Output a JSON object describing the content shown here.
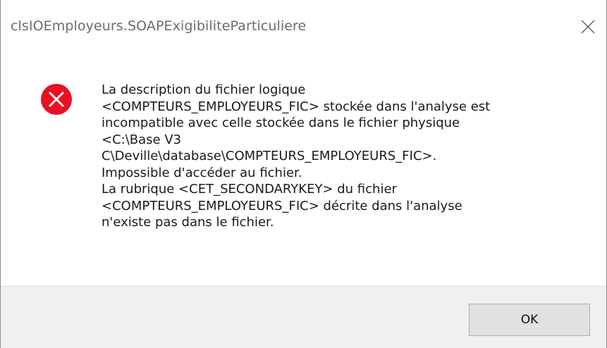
{
  "window": {
    "title": "clsIOEmployeurs.SOAPExigibiliteParticuliere",
    "close_icon": "close-icon"
  },
  "message": {
    "icon": "error-icon",
    "icon_color": "#e81123",
    "text": "La description du fichier logique\n<COMPTEURS_EMPLOYEURS_FIC> stockée dans l'analyse est\nincompatible avec celle stockée dans le fichier physique\n<C:\\Base V3\nC\\Deville\\database\\COMPTEURS_EMPLOYEURS_FIC>.\nImpossible d'accéder au fichier.\nLa rubrique <CET_SECONDARYKEY> du fichier\n<COMPTEURS_EMPLOYEURS_FIC> décrite dans l'analyse\nn'existe pas dans le fichier."
  },
  "buttons": {
    "ok_label": "OK"
  }
}
